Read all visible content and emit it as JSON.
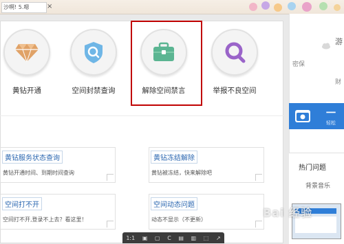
{
  "browser": {
    "tab_text": "沙啊! 5.嗯",
    "close_glyph": "×"
  },
  "service_icons": [
    {
      "label": "黄钻开通",
      "icon": "diamond-icon"
    },
    {
      "label": "空间封禁查询",
      "icon": "shield-search-icon"
    },
    {
      "label": "解除空间禁言",
      "icon": "briefcase-icon"
    },
    {
      "label": "举报不良空间",
      "icon": "magnifier-icon"
    }
  ],
  "cards": [
    {
      "title": "黄钻服务状态查询",
      "desc": "黄钻开通时间、到期时间查询"
    },
    {
      "title": "黄钻冻结解除",
      "desc": "黄钻被冻结，快来解除吧"
    },
    {
      "title": "空间打不开",
      "desc": "空间打不开,登录不上去？看这里！"
    },
    {
      "title": "空间动态问题",
      "desc": "动态不显示（不更新）"
    }
  ],
  "right_column": {
    "top_text": "游",
    "label_1": "密保",
    "label_2": "财",
    "blue_button_text": "一",
    "blue_button_sub": "轻松",
    "hot_title": "热门问题",
    "hot_item_1": "背景音乐"
  },
  "viewer_toolbar": [
    "1:1",
    "▣",
    "▢",
    "C",
    "▤",
    "▥",
    "⬚",
    "↗"
  ],
  "watermark": "Bai 经验",
  "colors": {
    "highlight_border": "#c00000",
    "card_title": "#2a66b0",
    "blue_button": "#2f7ed8"
  }
}
